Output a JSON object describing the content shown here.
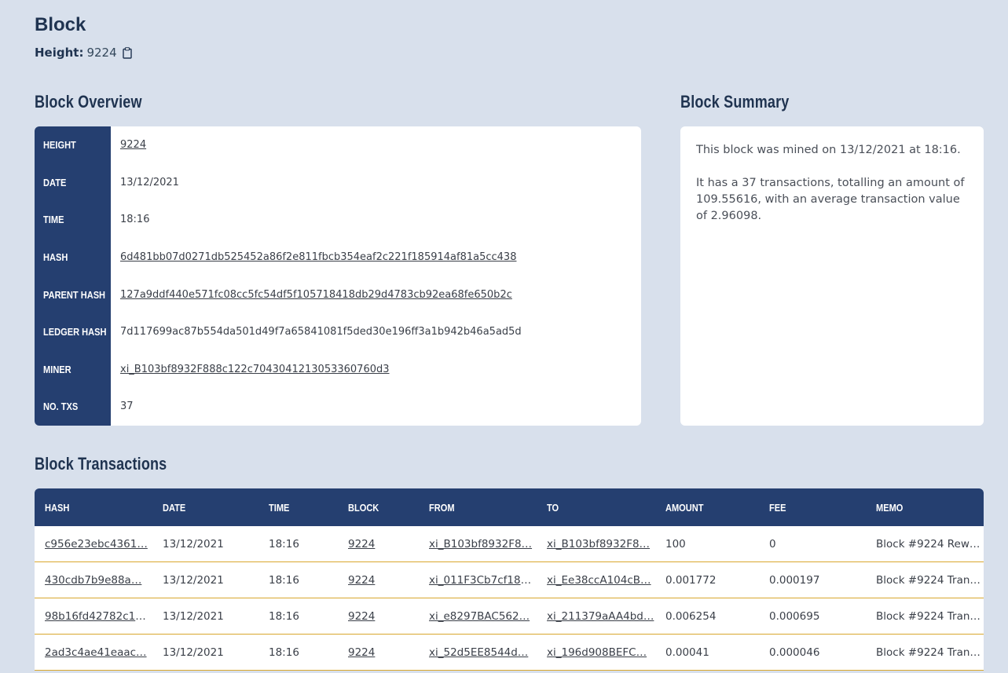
{
  "page": {
    "title": "Block",
    "height_label": "Height:",
    "height_value": "9224"
  },
  "overview": {
    "title": "Block Overview",
    "rows": [
      {
        "label": "HEIGHT",
        "value": "9224",
        "link": true
      },
      {
        "label": "DATE",
        "value": "13/12/2021",
        "link": false
      },
      {
        "label": "TIME",
        "value": "18:16",
        "link": false
      },
      {
        "label": "HASH",
        "value": "6d481bb07d0271db525452a86f2e811fbcb354eaf2c221f185914af81a5cc438",
        "link": true
      },
      {
        "label": "PARENT HASH",
        "value": "127a9ddf440e571fc08cc5fc54df5f105718418db29d4783cb92ea68fe650b2c",
        "link": true
      },
      {
        "label": "LEDGER HASH",
        "value": "7d117699ac87b554da501d49f7a65841081f5ded30e196ff3a1b942b46a5ad5d",
        "link": false
      },
      {
        "label": "MINER",
        "value": "xi_B103bf8932F888c122c7043041213053360760d3",
        "link": true
      },
      {
        "label": "NO. TXS",
        "value": "37",
        "link": false
      }
    ]
  },
  "summary": {
    "title": "Block Summary",
    "paragraph1": "This block was mined on 13/12/2021 at 18:16.",
    "paragraph2": "It has a 37 transactions, totalling an amount of 109.55616, with an average transaction value of 2.96098."
  },
  "transactions": {
    "title": "Block Transactions",
    "columns": [
      "HASH",
      "DATE",
      "TIME",
      "BLOCK",
      "FROM",
      "TO",
      "AMOUNT",
      "FEE",
      "MEMO"
    ],
    "rows": [
      {
        "hash": "c956e23ebc4361…",
        "date": "13/12/2021",
        "time": "18:16",
        "block": "9224",
        "from": "xi_B103bf8932F8…",
        "to": "xi_B103bf8932F8…",
        "amount": "100",
        "fee": "0",
        "memo": "Block #9224 Rew…"
      },
      {
        "hash": "430cdb7b9e88a…",
        "date": "13/12/2021",
        "time": "18:16",
        "block": "9224",
        "from": "xi_011F3Cb7cf18F…",
        "to": "xi_Ee38ccA104cB…",
        "amount": "0.001772",
        "fee": "0.000197",
        "memo": "Block #9224 Tran…"
      },
      {
        "hash": "98b16fd42782c1b…",
        "date": "13/12/2021",
        "time": "18:16",
        "block": "9224",
        "from": "xi_e8297BAC562…",
        "to": "xi_211379aAA4bd…",
        "amount": "0.006254",
        "fee": "0.000695",
        "memo": "Block #9224 Tran…"
      },
      {
        "hash": "2ad3c4ae41eaac…",
        "date": "13/12/2021",
        "time": "18:16",
        "block": "9224",
        "from": "xi_52d5EE8544d…",
        "to": "xi_196d908BEFC…",
        "amount": "0.00041",
        "fee": "0.000046",
        "memo": "Block #9224 Tran…"
      }
    ]
  },
  "colors": {
    "background": "#d8e0ec",
    "header_navy": "#253f70",
    "row_divider": "#d9a72e"
  }
}
